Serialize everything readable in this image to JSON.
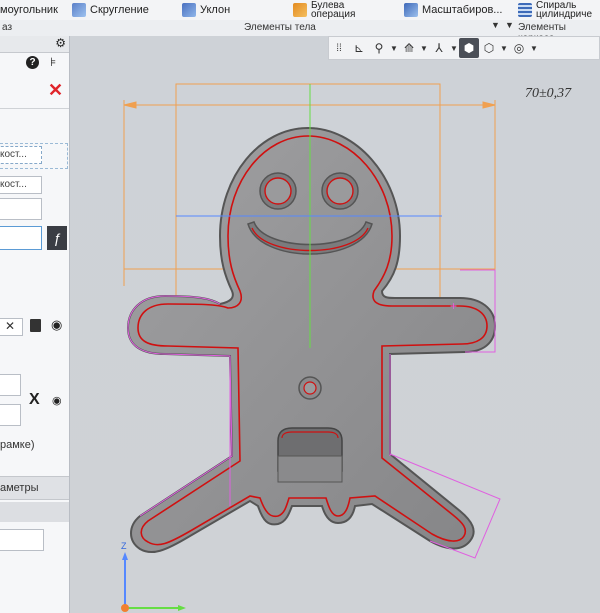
{
  "ribbon": {
    "items": [
      {
        "label": "моугольник"
      },
      {
        "label": "Скругление"
      },
      {
        "label": "Уклон"
      },
      {
        "label_line1": "Булева",
        "label_line2": "операция"
      },
      {
        "label": "Масштабиров..."
      },
      {
        "label_line1": "Спираль",
        "label_line2": "цилиндриче"
      }
    ],
    "groups": {
      "left_cut": "аз",
      "body": "Элементы тела",
      "frame": "Элементы каркаса"
    }
  },
  "panel": {
    "field1": "кост...",
    "field2": "кост...",
    "frame_text": "рамке)",
    "section_params": "аметры"
  },
  "viewport": {
    "dimension_label": "70±0,37",
    "axis_z": "Z"
  },
  "colors": {
    "body_fill": "#8f8f91",
    "outline_red": "#d01010",
    "guide_orange": "#f0a050",
    "guide_magenta": "#e060e0",
    "axis_green": "#66dd44",
    "axis_blue": "#5588ff"
  }
}
